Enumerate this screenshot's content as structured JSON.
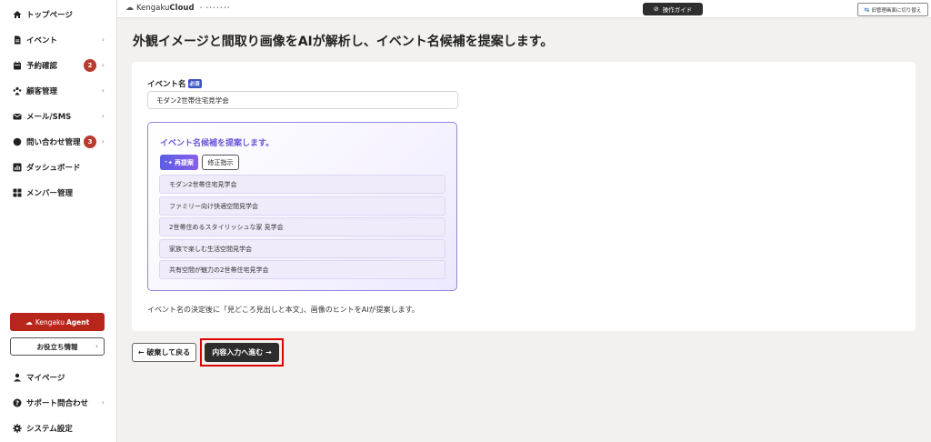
{
  "sidebar": {
    "items": [
      {
        "label": "トップページ",
        "icon": "home-icon"
      },
      {
        "label": "イベント",
        "icon": "document-icon"
      },
      {
        "label": "予約確認",
        "icon": "calendar-icon",
        "badge": "2"
      },
      {
        "label": "顧客管理",
        "icon": "customers-icon"
      },
      {
        "label": "メール/SMS",
        "icon": "mail-icon"
      },
      {
        "label": "問い合わせ管理",
        "icon": "chat-icon",
        "badge": "3"
      },
      {
        "label": "ダッシュボード",
        "icon": "chart-icon"
      },
      {
        "label": "メンバー管理",
        "icon": "grid-icon"
      }
    ],
    "agent_button": {
      "brand": "Kengaku",
      "word": "Agent"
    },
    "info_button": "お役立ち情報",
    "bottom_items": [
      {
        "label": "マイページ",
        "icon": "user-icon"
      },
      {
        "label": "サポート問合わせ",
        "icon": "help-icon"
      },
      {
        "label": "システム設定",
        "icon": "gear-icon"
      }
    ]
  },
  "topbar": {
    "logo_regular": "Kengaku",
    "logo_bold": "Cloud",
    "logo_dots": "•·•••••••",
    "guide_button": "操作ガイド",
    "switch_button": "旧管理画面に切り替え"
  },
  "main": {
    "title": "外観イメージと間取り画像をAIが解析し、イベント名候補を提案します。",
    "field_label": "イベント名",
    "required_badge": "必須",
    "event_name_value": "モダン2世帯住宅見学会",
    "suggest": {
      "title": "イベント名候補を提案します。",
      "regen_button": "再提案",
      "fix_button": "修正指示",
      "candidates": [
        "モダン2世帯住宅見学会",
        "ファミリー向け快適空間見学会",
        "2世帯住めるスタイリッシュな家 見学会",
        "家族で楽しむ生活空間見学会",
        "共有空間が魅力の2世帯住宅見学会"
      ]
    },
    "hint": "イベント名の決定後に「見どころ見出しと本文」、画像のヒントをAIが提案します。",
    "back_button": "← 破棄して戻る",
    "next_button": "内容入力へ進む →"
  },
  "colors": {
    "accent_red": "#b8261b",
    "badge_red": "#b93a2e",
    "ai_purple": "#6b57d8",
    "highlight": "#e00000"
  }
}
